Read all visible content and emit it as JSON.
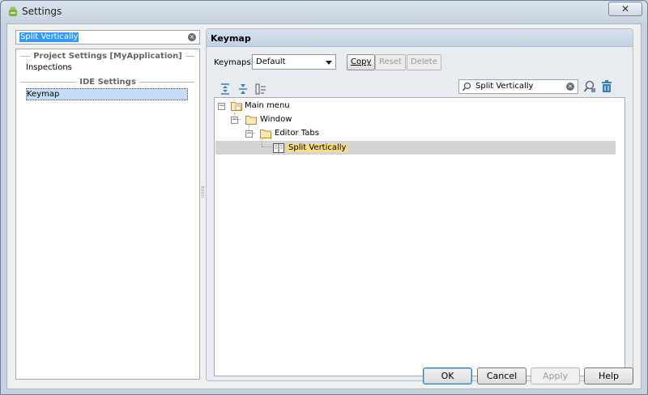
{
  "window": {
    "title": "Settings",
    "close_glyph": "✕"
  },
  "left": {
    "search_value": "Split Vertically",
    "groups": [
      {
        "header": "Project Settings [MyApplication]",
        "items": [
          "Inspections"
        ]
      },
      {
        "header": "IDE Settings",
        "items": [
          "Keymap"
        ]
      }
    ],
    "selected_item": "Keymap"
  },
  "right": {
    "title": "Keymap",
    "keymaps_label": "Keymaps:",
    "keymaps_value": "Default",
    "copy_label": "Copy",
    "reset_label": "Reset",
    "delete_label": "Delete",
    "filter_value": "Split Vertically",
    "tree": [
      {
        "label": "Main menu",
        "level": 0
      },
      {
        "label": "Window",
        "level": 1
      },
      {
        "label": "Editor Tabs",
        "level": 2
      },
      {
        "label": "Split Vertically",
        "level": 3,
        "selected": true
      }
    ]
  },
  "buttons": {
    "ok": "OK",
    "cancel": "Cancel",
    "apply": "Apply",
    "help": "Help"
  },
  "icons": {
    "app": "android-icon",
    "expand_all": "expand-all-icon",
    "collapse_all": "collapse-all-icon",
    "edit_shortcut": "edit-shortcut-icon",
    "search": "search-icon",
    "find_by_shortcut": "find-by-shortcut-icon",
    "delete": "trash-icon"
  },
  "colors": {
    "selection_highlight": "#fbdc7c",
    "selected_row": "#d4d4d4",
    "left_selection": "#c4dcf7"
  }
}
